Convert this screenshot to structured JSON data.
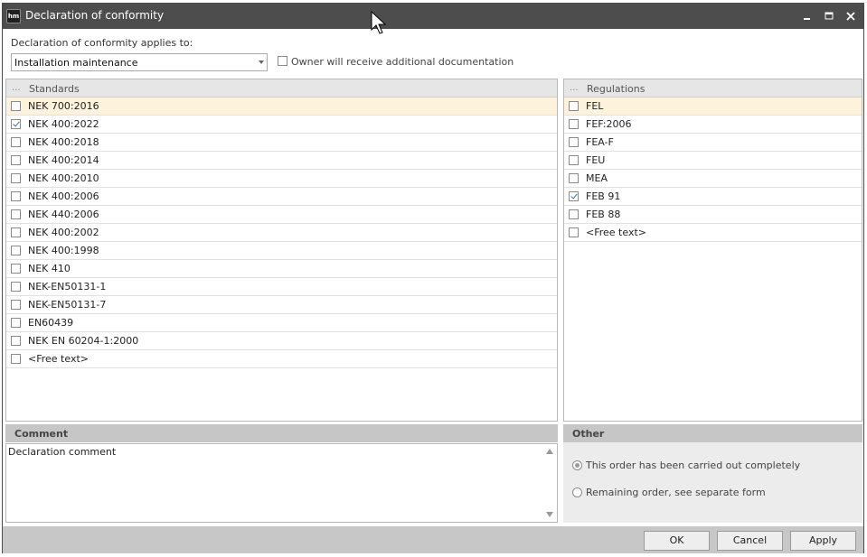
{
  "window": {
    "title": "Declaration of conformity",
    "app_icon_text": "hm"
  },
  "applies_to": {
    "label": "Declaration of conformity applies to:",
    "selected": "Installation maintenance"
  },
  "owner_doc": {
    "label": "Owner will receive additional documentation",
    "checked": false
  },
  "standards": {
    "dots": "...",
    "header": "Standards",
    "items": [
      {
        "label": "NEK 700:2016",
        "checked": false
      },
      {
        "label": "NEK 400:2022",
        "checked": true
      },
      {
        "label": "NEK 400:2018",
        "checked": false
      },
      {
        "label": "NEK 400:2014",
        "checked": false
      },
      {
        "label": "NEK 400:2010",
        "checked": false
      },
      {
        "label": "NEK 400:2006",
        "checked": false
      },
      {
        "label": "NEK 440:2006",
        "checked": false
      },
      {
        "label": "NEK 400:2002",
        "checked": false
      },
      {
        "label": "NEK 400:1998",
        "checked": false
      },
      {
        "label": "NEK 410",
        "checked": false
      },
      {
        "label": "NEK-EN50131-1",
        "checked": false
      },
      {
        "label": "NEK-EN50131-7",
        "checked": false
      },
      {
        "label": "EN60439",
        "checked": false
      },
      {
        "label": "NEK EN 60204-1:2000",
        "checked": false
      },
      {
        "label": "<Free text>",
        "checked": false
      }
    ]
  },
  "regulations": {
    "dots": "...",
    "header": "Regulations",
    "items": [
      {
        "label": "FEL",
        "checked": false
      },
      {
        "label": "FEF:2006",
        "checked": false
      },
      {
        "label": "FEA-F",
        "checked": false
      },
      {
        "label": "FEU",
        "checked": false
      },
      {
        "label": "MEA",
        "checked": false
      },
      {
        "label": "FEB 91",
        "checked": true
      },
      {
        "label": "FEB 88",
        "checked": false
      },
      {
        "label": "<Free text>",
        "checked": false
      }
    ]
  },
  "comment": {
    "header": "Comment",
    "text": "Declaration comment"
  },
  "other": {
    "header": "Other",
    "options": [
      {
        "label": "This order has been carried out completely",
        "selected": true
      },
      {
        "label": "Remaining order, see separate form",
        "selected": false
      }
    ]
  },
  "buttons": {
    "ok": "OK",
    "cancel": "Cancel",
    "apply": "Apply"
  },
  "colors": {
    "titlebar": "#4d4d4d",
    "highlight_row": "#fdf2dc",
    "check_mark": "#3a6ea5"
  }
}
